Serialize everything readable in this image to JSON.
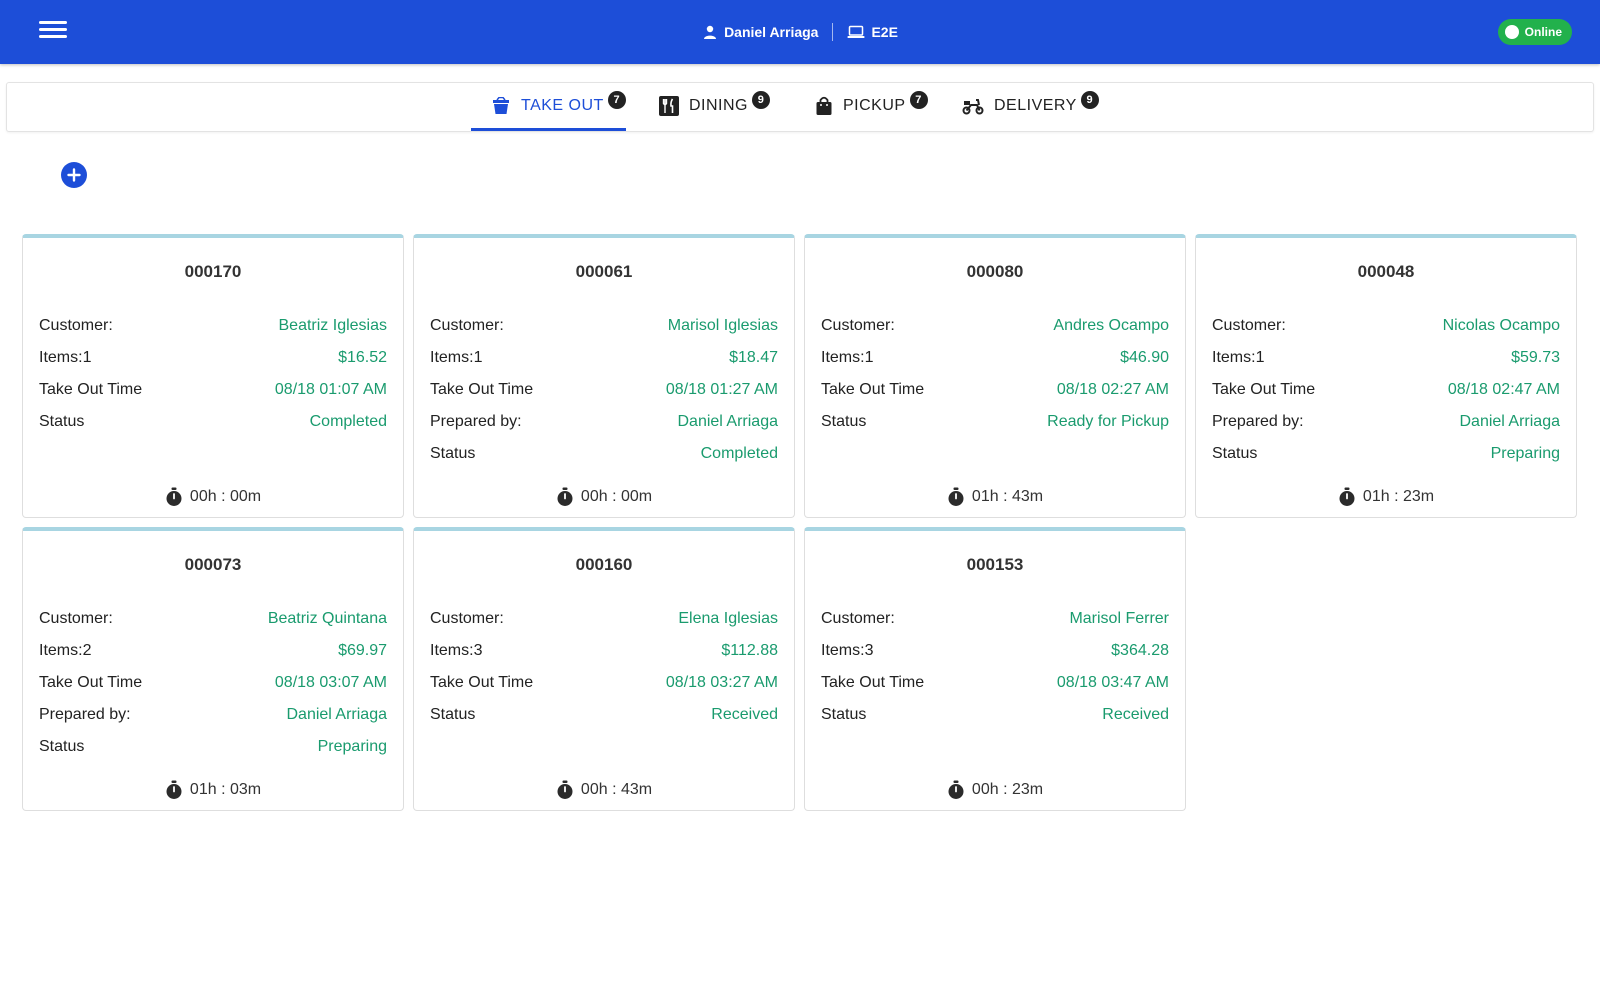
{
  "header": {
    "user_name": "Daniel Arriaga",
    "device": "E2E",
    "status": "Online",
    "bar_color": "#1d4ed8",
    "online_color": "#22b14c"
  },
  "tabs": [
    {
      "label": "TAKE OUT",
      "badge": "7",
      "icon": "take-out-icon",
      "active": true
    },
    {
      "label": "DINING",
      "badge": "9",
      "icon": "dining-icon"
    },
    {
      "label": "PICKUP",
      "badge": "7",
      "icon": "pickup-bag-icon"
    },
    {
      "label": "DELIVERY",
      "badge": "9",
      "icon": "delivery-scooter-icon"
    }
  ],
  "orders": [
    {
      "id": "000170",
      "rows": [
        {
          "label": "Customer:",
          "value": "Beatriz Iglesias"
        },
        {
          "label": "Items:1",
          "value": "$16.52"
        },
        {
          "label": "Take Out Time",
          "value": "08/18 01:07 AM"
        },
        {
          "label": "Status",
          "value": "Completed"
        }
      ],
      "timer": "00h : 00m"
    },
    {
      "id": "000061",
      "rows": [
        {
          "label": "Customer:",
          "value": "Marisol Iglesias"
        },
        {
          "label": "Items:1",
          "value": "$18.47"
        },
        {
          "label": "Take Out Time",
          "value": "08/18 01:27 AM"
        },
        {
          "label": "Prepared by:",
          "value": "Daniel Arriaga"
        },
        {
          "label": "Status",
          "value": "Completed"
        }
      ],
      "timer": "00h : 00m"
    },
    {
      "id": "000080",
      "rows": [
        {
          "label": "Customer:",
          "value": "Andres Ocampo"
        },
        {
          "label": "Items:1",
          "value": "$46.90"
        },
        {
          "label": "Take Out Time",
          "value": "08/18 02:27 AM"
        },
        {
          "label": "Status",
          "value": "Ready for Pickup"
        }
      ],
      "timer": "01h : 43m"
    },
    {
      "id": "000048",
      "rows": [
        {
          "label": "Customer:",
          "value": "Nicolas Ocampo"
        },
        {
          "label": "Items:1",
          "value": "$59.73"
        },
        {
          "label": "Take Out Time",
          "value": "08/18 02:47 AM"
        },
        {
          "label": "Prepared by:",
          "value": "Daniel Arriaga"
        },
        {
          "label": "Status",
          "value": "Preparing"
        }
      ],
      "timer": "01h : 23m"
    },
    {
      "id": "000073",
      "rows": [
        {
          "label": "Customer:",
          "value": "Beatriz Quintana"
        },
        {
          "label": "Items:2",
          "value": "$69.97"
        },
        {
          "label": "Take Out Time",
          "value": "08/18 03:07 AM"
        },
        {
          "label": "Prepared by:",
          "value": "Daniel Arriaga"
        },
        {
          "label": "Status",
          "value": "Preparing"
        }
      ],
      "timer": "01h : 03m"
    },
    {
      "id": "000160",
      "rows": [
        {
          "label": "Customer:",
          "value": "Elena Iglesias"
        },
        {
          "label": "Items:3",
          "value": "$112.88"
        },
        {
          "label": "Take Out Time",
          "value": "08/18 03:27 AM"
        },
        {
          "label": "Status",
          "value": "Received"
        }
      ],
      "timer": "00h : 43m"
    },
    {
      "id": "000153",
      "rows": [
        {
          "label": "Customer:",
          "value": "Marisol Ferrer"
        },
        {
          "label": "Items:3",
          "value": "$364.28"
        },
        {
          "label": "Take Out Time",
          "value": "08/18 03:47 AM"
        },
        {
          "label": "Status",
          "value": "Received"
        }
      ],
      "timer": "00h : 23m"
    }
  ]
}
